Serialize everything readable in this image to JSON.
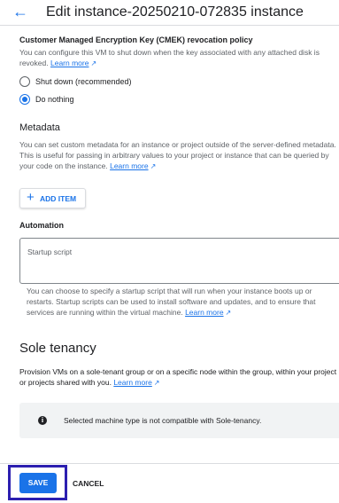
{
  "header": {
    "back_icon": "arrow-back-icon",
    "title": "Edit instance-20250210-072835 instance"
  },
  "cmek": {
    "title": "Customer Managed Encryption Key (CMEK) revocation policy",
    "desc_line1": "You can configure this VM to shut down when the key associated with any attached disk is",
    "desc_line2_prefix": "revoked.",
    "learn_more": "Learn more",
    "options": [
      {
        "label": "Shut down (recommended)",
        "selected": false
      },
      {
        "label": "Do nothing",
        "selected": true
      }
    ]
  },
  "metadata": {
    "title": "Metadata",
    "desc_line1": "You can set custom metadata for an instance or project outside of the server-defined metadata.",
    "desc_line2": "This is useful for passing in arbitrary values to your project or instance that can be queried by",
    "desc_line3_prefix": "your code on the instance.",
    "learn_more": "Learn more",
    "add_item_label": "ADD ITEM"
  },
  "automation": {
    "title": "Automation",
    "startup_placeholder": "Startup script",
    "desc_line1": "You can choose to specify a startup script that will run when your instance boots up or",
    "desc_line2": "restarts. Startup scripts can be used to install software and updates, and to ensure that",
    "desc_line3_prefix": "services are running within the virtual machine.",
    "learn_more": "Learn more"
  },
  "sole_tenancy": {
    "title": "Sole tenancy",
    "desc_line1": "Provision VMs on a sole-tenant group or on a specific node within the group, within your project",
    "desc_line2_prefix": "or projects shared with you.",
    "learn_more": "Learn more",
    "info_icon": "info-icon",
    "info_text": "Selected machine type is not compatible with Sole-tenancy."
  },
  "footer": {
    "save_label": "SAVE",
    "cancel_label": "CANCEL"
  },
  "colors": {
    "accent": "#1a73e8",
    "highlight_border": "#2c1fb0"
  }
}
